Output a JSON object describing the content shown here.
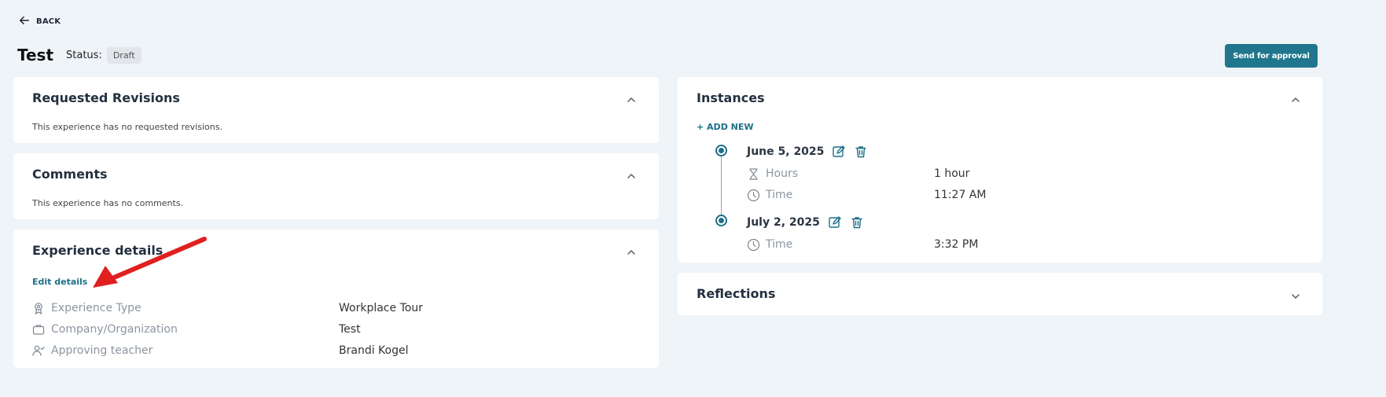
{
  "nav": {
    "back_label": "BACK"
  },
  "header": {
    "title": "Test",
    "status_label": "Status:",
    "status_value": "Draft",
    "approve_button": "Send for approval"
  },
  "revisions": {
    "title": "Requested Revisions",
    "empty_text": "This experience has no requested revisions."
  },
  "comments": {
    "title": "Comments",
    "empty_text": "This experience has no comments."
  },
  "experience": {
    "title": "Experience details",
    "edit_link": "Edit details",
    "rows": [
      {
        "icon": "award-icon",
        "label": "Experience Type",
        "value": "Workplace Tour"
      },
      {
        "icon": "briefcase-icon",
        "label": "Company/Organization",
        "value": "Test"
      },
      {
        "icon": "user-check-icon",
        "label": "Approving teacher",
        "value": "Brandi Kogel"
      }
    ]
  },
  "instances": {
    "title": "Instances",
    "add_new": "+ ADD NEW",
    "items": [
      {
        "date": "June 5, 2025",
        "rows": [
          {
            "icon": "hourglass-icon",
            "label": "Hours",
            "value": "1 hour"
          },
          {
            "icon": "clock-icon",
            "label": "Time",
            "value": "11:27 AM"
          }
        ]
      },
      {
        "date": "July 2, 2025",
        "rows": [
          {
            "icon": "clock-icon",
            "label": "Time",
            "value": "3:32 PM"
          }
        ]
      }
    ]
  },
  "reflections": {
    "title": "Reflections"
  },
  "colors": {
    "accent": "#20778d",
    "background": "#eff4f9",
    "annotation_arrow": "#e02020"
  }
}
